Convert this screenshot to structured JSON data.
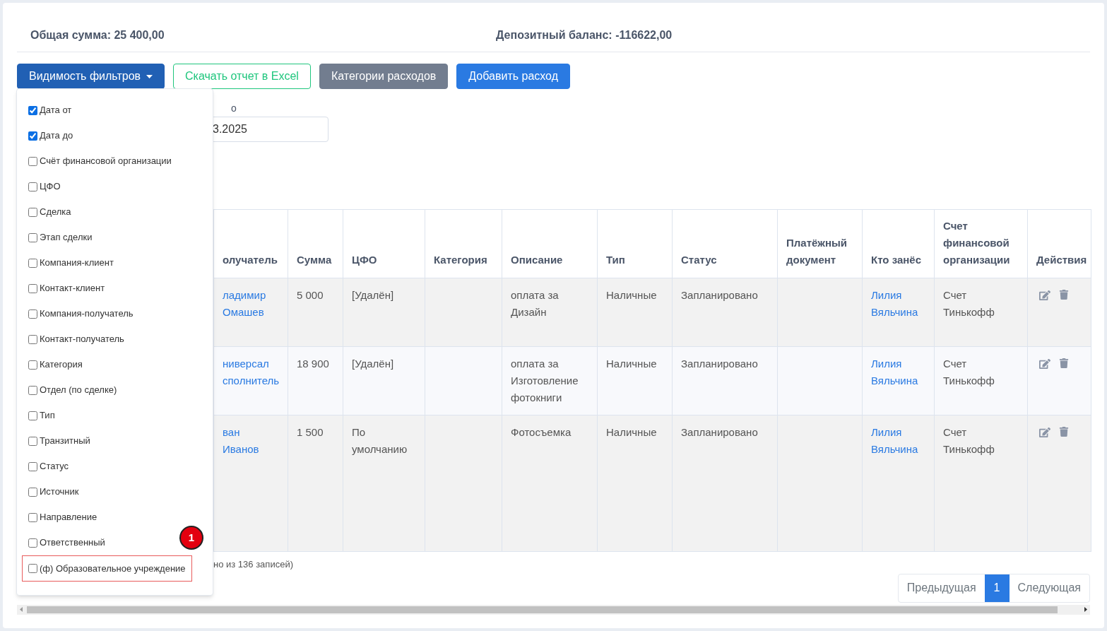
{
  "summary": {
    "total": "Общая сумма: 25 400,00",
    "deposit": "Депозитный баланс: -116622,00"
  },
  "toolbar": [
    {
      "label": "Видимость фильтров",
      "kind": "dropdown"
    },
    {
      "label": "Скачать отчет в Excel",
      "kind": "outline"
    },
    {
      "label": "Категории расходов",
      "kind": "secondary"
    },
    {
      "label": "Добавить расход",
      "kind": "primary"
    }
  ],
  "filter_menu": {
    "annotation": "1",
    "items": [
      {
        "label": "Дата от",
        "checked": true,
        "highlighted": false
      },
      {
        "label": "Дата до",
        "checked": true,
        "highlighted": false
      },
      {
        "label": "Счёт финансовой организации",
        "checked": false,
        "highlighted": false
      },
      {
        "label": "ЦФО",
        "checked": false,
        "highlighted": false
      },
      {
        "label": "Сделка",
        "checked": false,
        "highlighted": false
      },
      {
        "label": "Этап сделки",
        "checked": false,
        "highlighted": false
      },
      {
        "label": "Компания-клиент",
        "checked": false,
        "highlighted": false
      },
      {
        "label": "Контакт-клиент",
        "checked": false,
        "highlighted": false
      },
      {
        "label": "Компания-получатель",
        "checked": false,
        "highlighted": false
      },
      {
        "label": "Контакт-получатель",
        "checked": false,
        "highlighted": false
      },
      {
        "label": "Категория",
        "checked": false,
        "highlighted": false
      },
      {
        "label": "Отдел (по сделке)",
        "checked": false,
        "highlighted": false
      },
      {
        "label": "Тип",
        "checked": false,
        "highlighted": false
      },
      {
        "label": "Транзитный",
        "checked": false,
        "highlighted": false
      },
      {
        "label": "Статус",
        "checked": false,
        "highlighted": false
      },
      {
        "label": "Источник",
        "checked": false,
        "highlighted": false
      },
      {
        "label": "Направление",
        "checked": false,
        "highlighted": false
      },
      {
        "label": "Ответственный",
        "checked": false,
        "highlighted": false
      },
      {
        "label": "(ф) Образовательное учреждение",
        "checked": false,
        "highlighted": true
      }
    ]
  },
  "filters": {
    "label": "о",
    "value": "3.2025"
  },
  "table": {
    "columns": [
      {
        "label": "олучатель",
        "kind": "link"
      },
      {
        "label": "Сумма",
        "kind": "text"
      },
      {
        "label": "ЦФО",
        "kind": "text"
      },
      {
        "label": "Категория",
        "kind": "text"
      },
      {
        "label": "Описание",
        "kind": "text"
      },
      {
        "label": "Тип",
        "kind": "text"
      },
      {
        "label": "Статус",
        "kind": "text"
      },
      {
        "label": "Платёжный документ",
        "kind": "text"
      },
      {
        "label": "Кто занёс",
        "kind": "link"
      },
      {
        "label": "Счет финансовой организации",
        "kind": "text"
      },
      {
        "label": "Действия",
        "kind": "actions"
      }
    ],
    "rows": [
      {
        "cells": [
          "ладимир Омашев",
          "5 000",
          "[Удалён]",
          "",
          "оплата за Дизайн",
          "Наличные",
          "Запланировано",
          "",
          "Лилия Вяльчина",
          "Счет Тинькофф"
        ]
      },
      {
        "cells": [
          "ниверсал сполнитель",
          "18 900",
          "[Удалён]",
          "",
          "оплата за Изготовление фотокниги",
          "Наличные",
          "Запланировано",
          "",
          "Лилия Вяльчина",
          "Счет Тинькофф"
        ]
      },
      {
        "cells": [
          "ван Иванов",
          "1 500",
          "По умолчанию",
          "",
          "Фотосъемка",
          "Наличные",
          "Запланировано",
          "",
          "Лилия Вяльчина",
          "Счет Тинькофф"
        ]
      }
    ]
  },
  "info": "но из 136 записей)",
  "pagination": {
    "previous": "Предыдущая",
    "pages": [
      {
        "label": "1",
        "selected": true
      }
    ],
    "next": "Следующая"
  }
}
